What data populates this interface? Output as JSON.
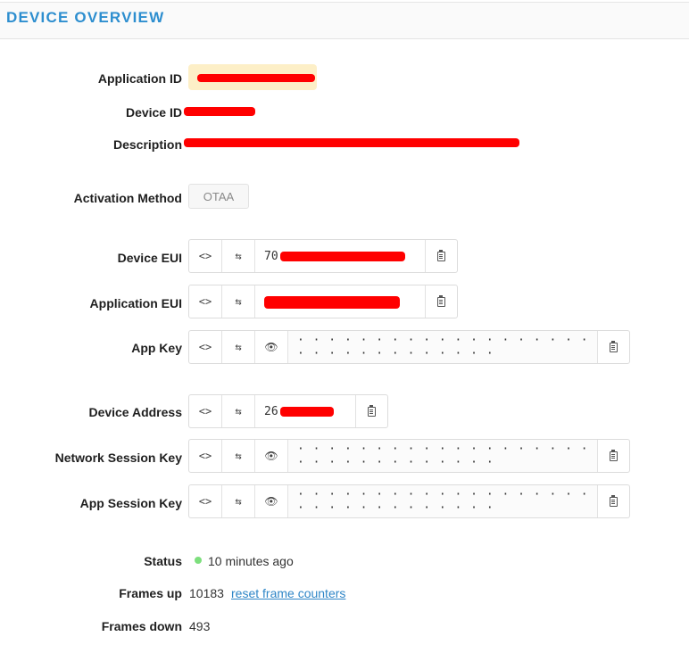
{
  "header": {
    "title": "DEVICE OVERVIEW"
  },
  "fields": {
    "application_id": {
      "label": "Application ID",
      "value": ""
    },
    "device_id": {
      "label": "Device ID"
    },
    "description": {
      "label": "Description"
    },
    "activation_method": {
      "label": "Activation Method",
      "value": "OTAA"
    },
    "device_eui": {
      "label": "Device EUI",
      "value": "70"
    },
    "application_eui": {
      "label": "Application EUI",
      "value": ""
    },
    "app_key": {
      "label": "App Key",
      "masked": "· · · · · · · · · · · · · · · · · · · · · · · · · · · · · · · ·"
    },
    "device_address": {
      "label": "Device Address",
      "value": "26"
    },
    "network_session_key": {
      "label": "Network Session Key",
      "masked": "· · · · · · · · · · · · · · · · · · · · · · · · · · · · · · · ·"
    },
    "app_session_key": {
      "label": "App Session Key",
      "masked": "· · · · · · · · · · · · · · · · · · · · · · · · · · · · · · · ·"
    }
  },
  "status": {
    "label": "Status",
    "value": "10 minutes ago",
    "dot_color": "#7ddf7d"
  },
  "frames_up": {
    "label": "Frames up",
    "value": "10183",
    "reset_link": "reset frame counters"
  },
  "frames_down": {
    "label": "Frames down",
    "value": "493"
  },
  "key_buttons": {
    "format": "<>",
    "swap": "⇆",
    "show": "👁"
  },
  "icons": [
    "code-toggle-icon",
    "byte-order-swap-icon",
    "eye-icon",
    "clipboard-icon"
  ],
  "colors": {
    "accent": "#2d8ecf",
    "redaction": "#ff0000",
    "app_id_bg": "#fdefc7"
  }
}
